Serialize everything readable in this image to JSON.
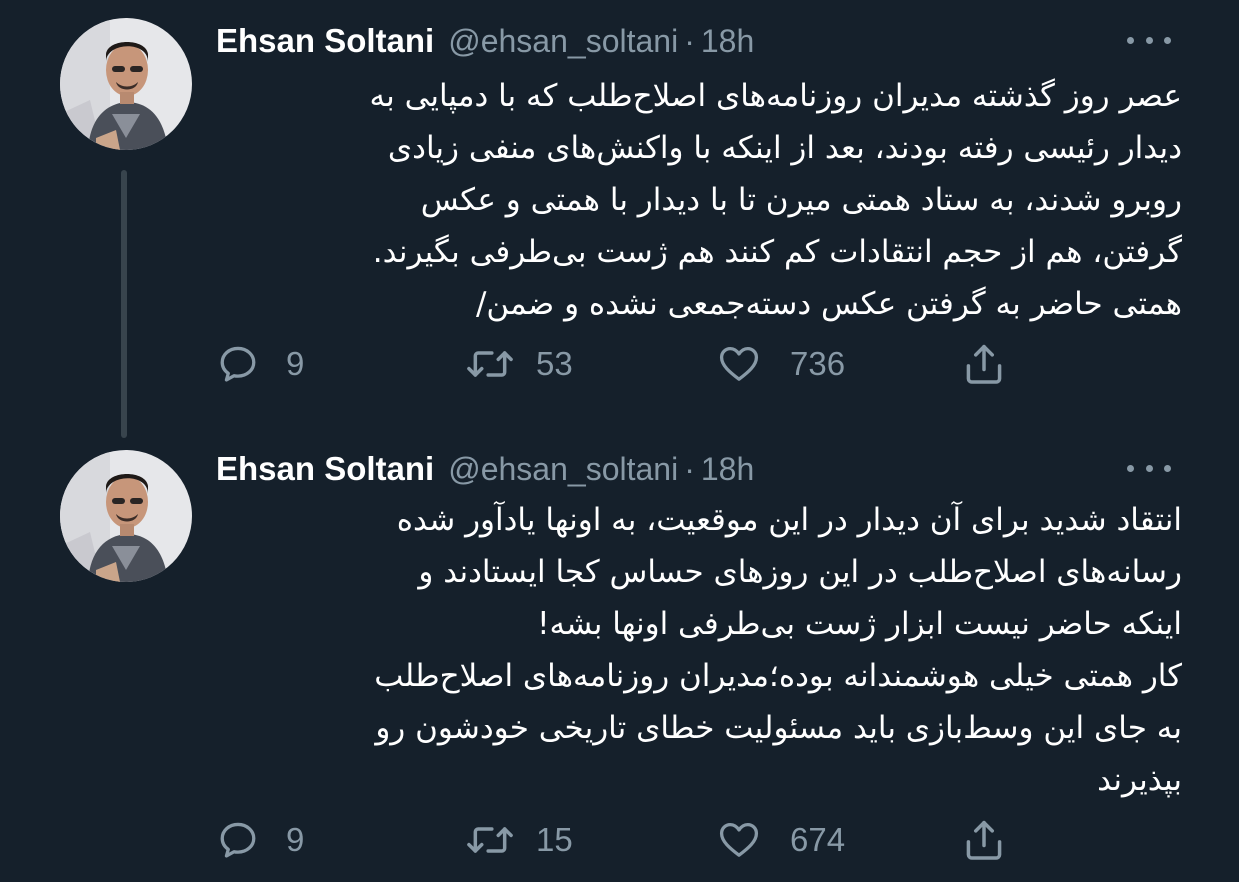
{
  "tweets": [
    {
      "author": {
        "name": "Ehsan Soltani",
        "handle": "@ehsan_soltani",
        "time": "18h"
      },
      "separator": "·",
      "lines": [
        "عصر روز گذشته مدیران روزنامه‌های اصلاح‌طلب که با دمپایی به",
        "دیدار رئیسی رفته بودند، بعد از اینکه با واکنش‌های منفی زیادی",
        "روبرو شدند، به ستاد همتی میرن تا با دیدار با همتی و عکس",
        "گرفتن، هم از حجم انتقادات کم کنند هم ژست بی‌طرفی بگیرند.",
        "همتی حاضر به گرفتن عکس دسته‌جمعی نشده و ضمن/"
      ],
      "stats": {
        "replies": "9",
        "retweets": "53",
        "likes": "736"
      }
    },
    {
      "author": {
        "name": "Ehsan Soltani",
        "handle": "@ehsan_soltani",
        "time": "18h"
      },
      "separator": "·",
      "lines": [
        "انتقاد شدید برای آن دیدار در این موقعیت، به اونها یادآور شده",
        "رسانه‌های اصلاح‌طلب در این روزهای حساس کجا ایستادند و",
        "اینکه حاضر نیست ابزار ژست بی‌طرفی اونها بشه!",
        "کار همتی خیلی هوشمندانه بوده؛مدیران روزنامه‌های اصلاح‌طلب",
        "به جای این وسط‌بازی باید مسئولیت خطای تاریخی خودشون رو",
        "بپذیرند"
      ],
      "stats": {
        "replies": "9",
        "retweets": "15",
        "likes": "674"
      }
    }
  ],
  "icons": {
    "reply": "reply-icon",
    "retweet": "retweet-icon",
    "like": "heart-icon",
    "share": "share-icon",
    "more": "more-icon"
  },
  "colors": {
    "background": "#15202b",
    "text": "#ffffff",
    "secondary": "#8899a6",
    "thread_line": "#38444d"
  }
}
